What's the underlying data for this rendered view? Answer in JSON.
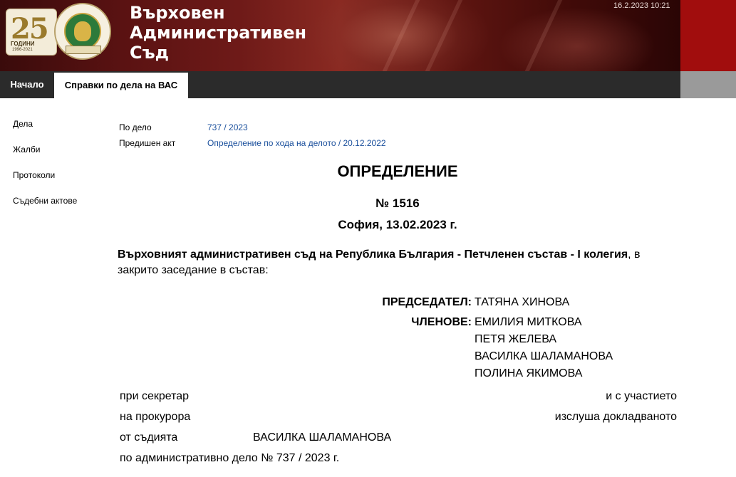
{
  "header": {
    "court_name_lines": [
      "Върховен",
      "Административен",
      "Съд"
    ],
    "datetime": "16.2.2023 10:21",
    "logo": {
      "number": "25",
      "label": "ГОДИНИ",
      "years": "1996-2021"
    },
    "colors": {
      "banner": "#5a1212",
      "red_block": "#a10d0d",
      "nav": "#2b2b2b",
      "link": "#1a4f9c"
    }
  },
  "nav": {
    "home": "Начало",
    "cases": "Справки по дела на ВАС"
  },
  "sidebar": {
    "items": [
      {
        "label": "Дела"
      },
      {
        "label": "Жалби"
      },
      {
        "label": "Протоколи"
      },
      {
        "label": "Съдебни актове"
      }
    ]
  },
  "meta": {
    "case_label": "По дело",
    "case_value": "737 / 2023",
    "prev_act_label": "Предишен акт",
    "prev_act_value": "Определение по хода на делото / 20.12.2022"
  },
  "document": {
    "title": "ОПРЕДЕЛЕНИЕ",
    "number": "№ 1516",
    "place_date": "София, 13.02.2023 г.",
    "intro_bold": "Върховният административен съд на Република България - Петчленен състав - I колегия",
    "intro_rest": ", в закрито заседание в състав:",
    "chairman_label": "ПРЕДСЕДАТЕЛ:",
    "chairman": "ТАТЯНА ХИНОВА",
    "members_label": "ЧЛЕНОВЕ:",
    "members": [
      "ЕМИЛИЯ МИТКОВА",
      "ПЕТЯ ЖЕЛЕВА",
      "ВАСИЛКА ШАЛАМАНОВА",
      "ПОЛИНА ЯКИМОВА"
    ],
    "secretary_label": "при секретар",
    "participation_label": "и с участието",
    "prosecutor_label": "на прокурора",
    "heard_label": "изслуша докладваното",
    "judge_label": "от съдията",
    "judge_name": "ВАСИЛКА ШАЛАМАНОВА",
    "case_line": "по административно дело № 737 / 2023 г."
  }
}
